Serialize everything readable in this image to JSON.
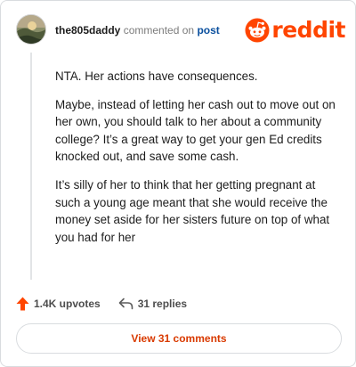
{
  "header": {
    "username": "the805daddy",
    "action": "commented on",
    "post_link": "post",
    "logo_text": "reddit"
  },
  "comment": {
    "paragraphs": [
      "NTA. Her actions have consequences.",
      "Maybe, instead of letting her cash out to move out on her own, you should talk to her about a community college? It’s a great way to get your gen Ed credits knocked out, and save some cash.",
      "It’s silly of her to think that her getting pregnant at such a young age meant that she would receive the money set aside for her sisters future on top of what you had for her"
    ]
  },
  "stats": {
    "upvotes": "1.4K upvotes",
    "replies": "31 replies"
  },
  "footer": {
    "view_comments_label": "View 31 comments"
  },
  "icons": {
    "avatar": "avatar-photo",
    "logo": "reddit-snoo-icon",
    "upvote": "upvote-arrow-icon",
    "reply": "reply-arrow-icon"
  },
  "colors": {
    "brand": "#ff4500",
    "link": "#0a4f9e",
    "button_text": "#d93a00"
  }
}
